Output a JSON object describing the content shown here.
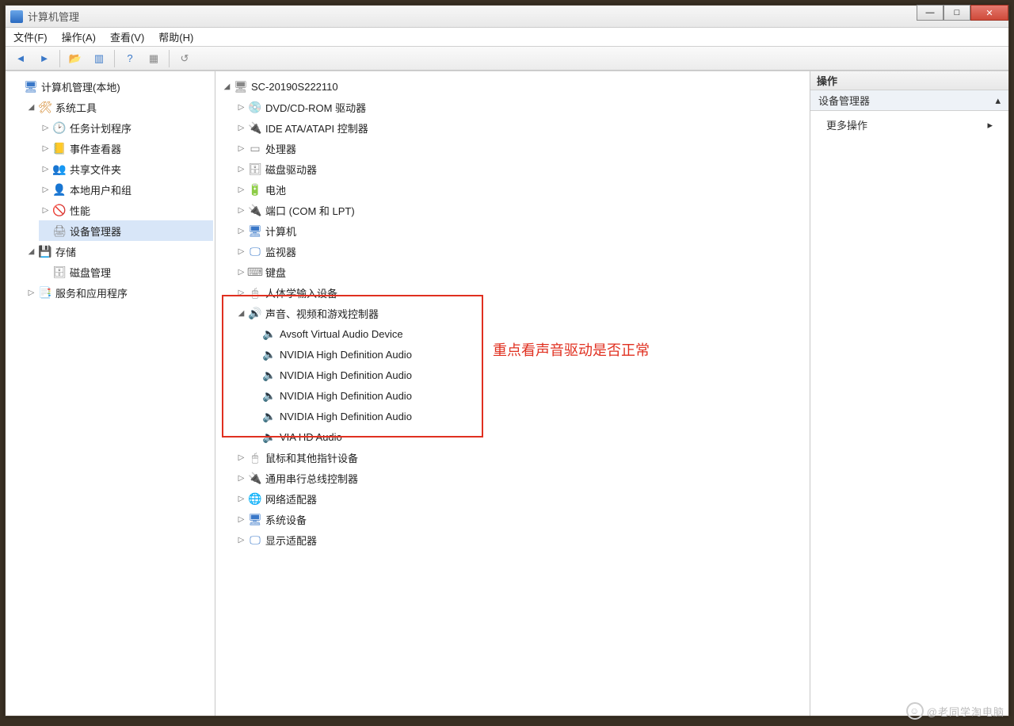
{
  "window": {
    "title": "计算机管理"
  },
  "menu": {
    "file": "文件(F)",
    "action": "操作(A)",
    "view": "查看(V)",
    "help": "帮助(H)"
  },
  "left_tree": {
    "root": "计算机管理(本地)",
    "system_tools": "系统工具",
    "task_scheduler": "任务计划程序",
    "event_viewer": "事件查看器",
    "shared_folders": "共享文件夹",
    "local_users": "本地用户和组",
    "performance": "性能",
    "device_manager": "设备管理器",
    "storage": "存储",
    "disk_mgmt": "磁盘管理",
    "services_apps": "服务和应用程序"
  },
  "center_tree": {
    "root": "SC-20190S222110",
    "dvd": "DVD/CD-ROM 驱动器",
    "ide": "IDE ATA/ATAPI 控制器",
    "cpu": "处理器",
    "disk_drive": "磁盘驱动器",
    "battery": "电池",
    "ports": "端口 (COM 和 LPT)",
    "computers": "计算机",
    "monitors": "监视器",
    "keyboards": "键盘",
    "hid": "人体学输入设备",
    "sound": "声音、视频和游戏控制器",
    "sound_children": [
      "Avsoft Virtual Audio Device",
      "NVIDIA High Definition Audio",
      "NVIDIA High Definition Audio",
      "NVIDIA High Definition Audio",
      "NVIDIA High Definition Audio",
      "VIA HD Audio"
    ],
    "mouse": "鼠标和其他指针设备",
    "usb": "通用串行总线控制器",
    "network": "网络适配器",
    "system_dev": "系统设备",
    "display": "显示适配器"
  },
  "actions": {
    "header": "操作",
    "sub": "设备管理器",
    "more": "更多操作"
  },
  "annotation": "重点看声音驱动是否正常",
  "watermark": "@老同学淘电脑"
}
